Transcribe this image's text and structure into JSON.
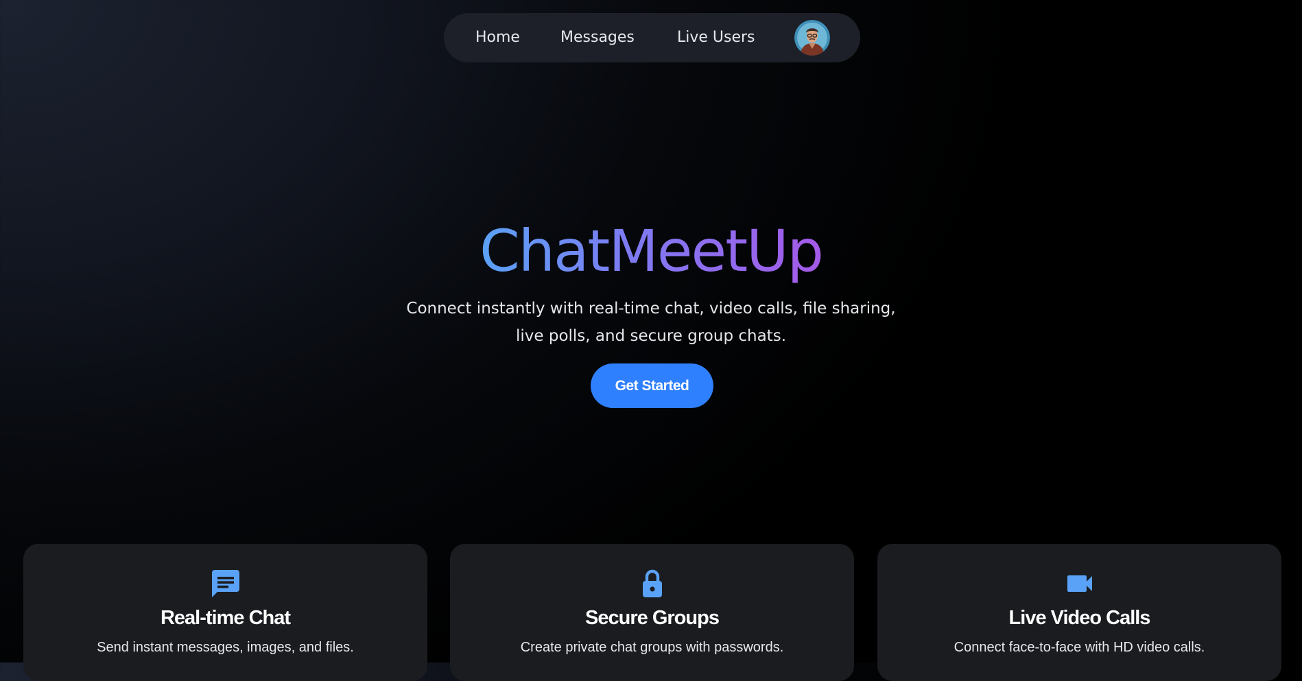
{
  "nav": {
    "links": [
      "Home",
      "Messages",
      "Live Users"
    ],
    "avatar_icon": "user-avatar"
  },
  "hero": {
    "title": "ChatMeetUp",
    "subtitle": "Connect instantly with real-time chat, video calls, file sharing, live polls, and secure group chats.",
    "cta_label": "Get Started"
  },
  "features": [
    {
      "icon": "chat-icon",
      "title": "Real-time Chat",
      "description": "Send instant messages, images, and files."
    },
    {
      "icon": "lock-icon",
      "title": "Secure Groups",
      "description": "Create private chat groups with passwords."
    },
    {
      "icon": "video-camera-icon",
      "title": "Live Video Calls",
      "description": "Connect face-to-face with HD video calls."
    }
  ],
  "colors": {
    "accent": "#2f80ff",
    "icon": "#5aa2f7",
    "title_gradient_start": "#5aa2f7",
    "title_gradient_end": "#a45ae8"
  }
}
